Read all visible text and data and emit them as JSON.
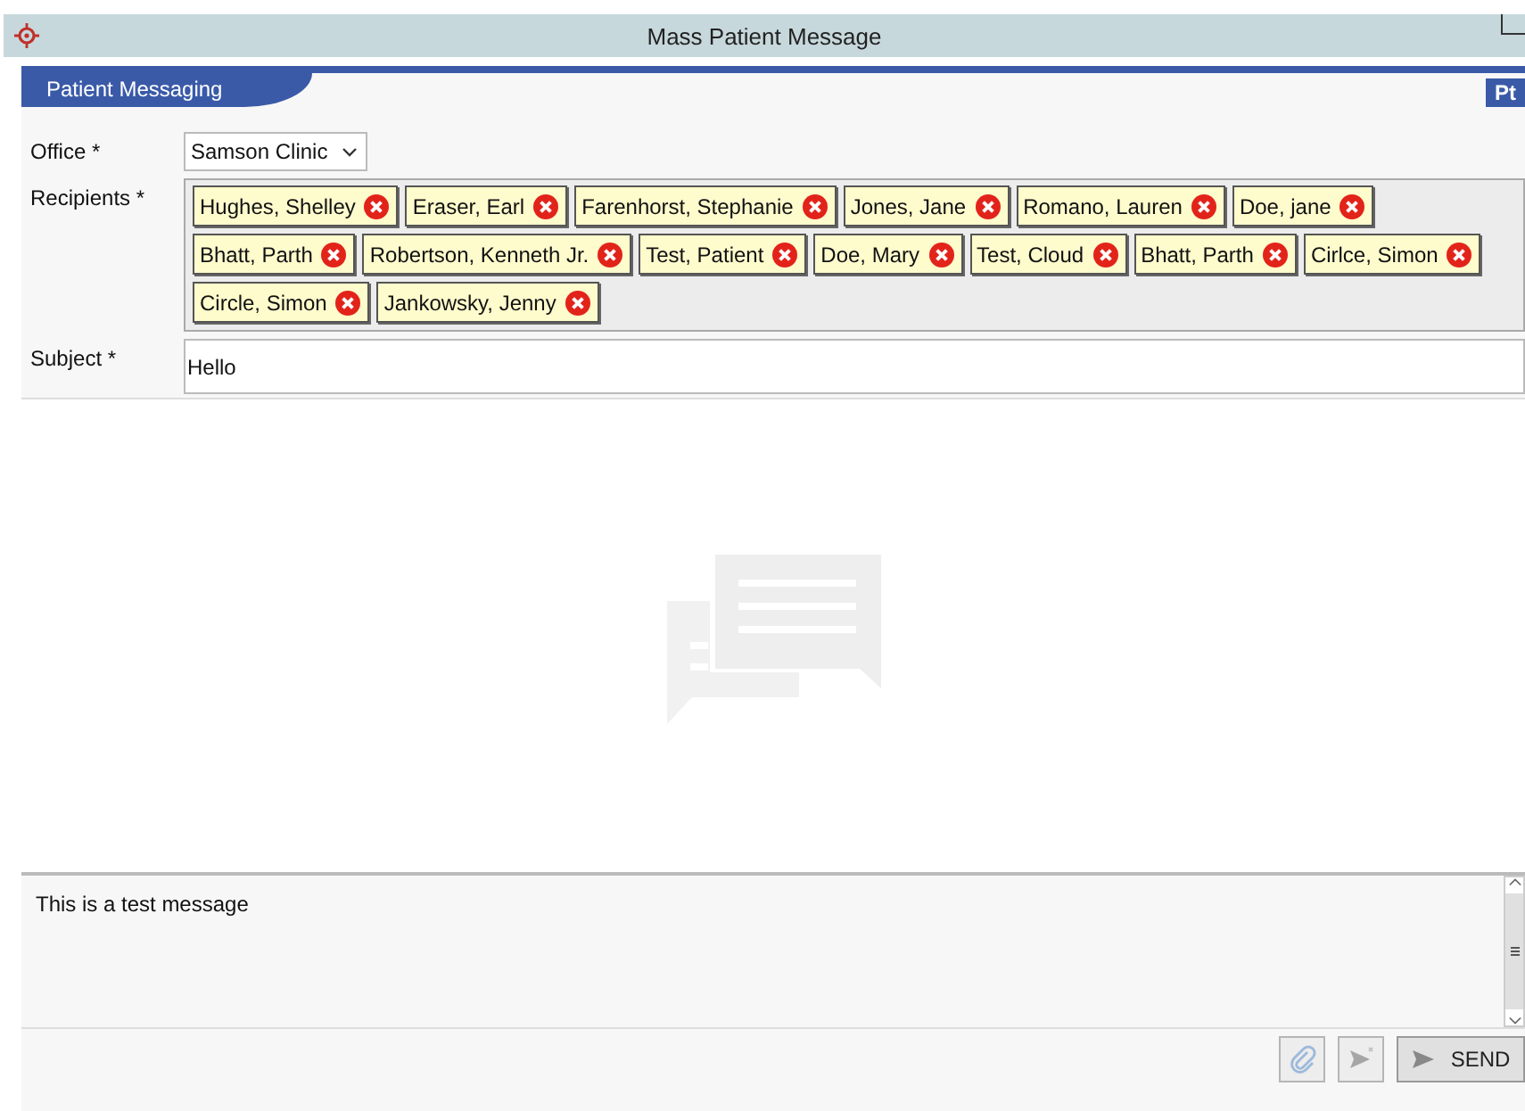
{
  "window": {
    "title": "Mass Patient Message"
  },
  "tab": {
    "label": "Patient Messaging",
    "badge": "Pt"
  },
  "form": {
    "office": {
      "label": "Office *",
      "value": "Samson Clinic"
    },
    "recipients": {
      "label": "Recipients *",
      "items": [
        {
          "name": "Hughes, Shelley"
        },
        {
          "name": "Eraser, Earl"
        },
        {
          "name": "Farenhorst, Stephanie"
        },
        {
          "name": "Jones, Jane"
        },
        {
          "name": "Romano, Lauren"
        },
        {
          "name": "Doe, jane"
        },
        {
          "name": "Bhatt, Parth"
        },
        {
          "name": "Robertson, Kenneth Jr."
        },
        {
          "name": "Test, Patient"
        },
        {
          "name": "Doe, Mary"
        },
        {
          "name": "Test, Cloud"
        },
        {
          "name": "Bhatt, Parth"
        },
        {
          "name": "Cirlce, Simon"
        },
        {
          "name": "Circle, Simon"
        },
        {
          "name": "Jankowsky, Jenny"
        }
      ]
    },
    "subject": {
      "label": "Subject *",
      "value": "Hello"
    }
  },
  "compose": {
    "value": "This is a test message"
  },
  "actions": [
    {
      "kind": "attach",
      "disabled": true
    },
    {
      "kind": "cancel-send",
      "disabled": true
    },
    {
      "kind": "send",
      "label": "SEND",
      "disabled": false
    }
  ]
}
